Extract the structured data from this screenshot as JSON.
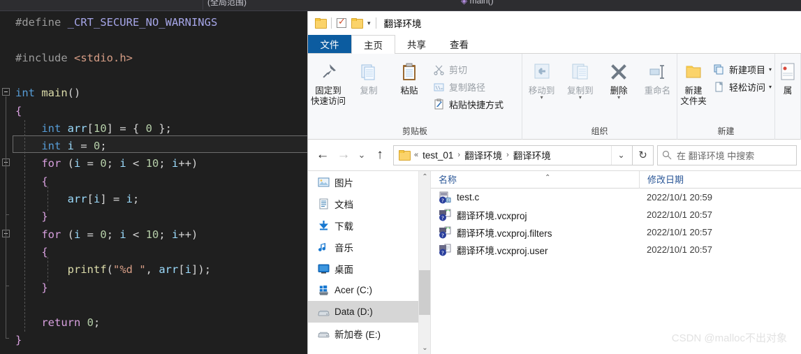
{
  "editor": {
    "combo_scope": "(全局范围)",
    "combo_function": "main()",
    "code_lines": [
      {
        "indent": 1,
        "tokens": [
          {
            "t": "#define ",
            "c": "c-pp"
          },
          {
            "t": "_CRT_SECURE_NO_WARNINGS",
            "c": "c-ppname"
          }
        ]
      },
      {
        "indent": 1,
        "tokens": []
      },
      {
        "indent": 1,
        "tokens": [
          {
            "t": "#include ",
            "c": "c-pp"
          },
          {
            "t": "<stdio.h>",
            "c": "c-str"
          }
        ]
      },
      {
        "indent": 1,
        "tokens": []
      },
      {
        "indent": 0,
        "tokens": [
          {
            "t": "int ",
            "c": "c-kw"
          },
          {
            "t": "main",
            "c": "c-fn"
          },
          {
            "t": "()",
            "c": "c-punct"
          }
        ]
      },
      {
        "indent": 0,
        "tokens": [
          {
            "t": "{",
            "c": "c-brace"
          }
        ]
      },
      {
        "indent": 0,
        "tokens": [
          {
            "t": "    ",
            "c": "c-punct"
          },
          {
            "t": "int ",
            "c": "c-kw"
          },
          {
            "t": "arr",
            "c": "c-var"
          },
          {
            "t": "[",
            "c": "c-punct"
          },
          {
            "t": "10",
            "c": "c-num"
          },
          {
            "t": "] = { ",
            "c": "c-punct"
          },
          {
            "t": "0",
            "c": "c-num"
          },
          {
            "t": " };",
            "c": "c-punct"
          }
        ]
      },
      {
        "indent": 0,
        "tokens": [
          {
            "t": "    ",
            "c": "c-punct"
          },
          {
            "t": "int ",
            "c": "c-kw"
          },
          {
            "t": "i",
            "c": "c-var"
          },
          {
            "t": " = ",
            "c": "c-punct"
          },
          {
            "t": "0",
            "c": "c-num"
          },
          {
            "t": ";",
            "c": "c-punct"
          }
        ]
      },
      {
        "indent": 0,
        "tokens": [
          {
            "t": "    ",
            "c": "c-punct"
          },
          {
            "t": "for",
            "c": "c-kw2"
          },
          {
            "t": " (",
            "c": "c-punct"
          },
          {
            "t": "i",
            "c": "c-var"
          },
          {
            "t": " = ",
            "c": "c-punct"
          },
          {
            "t": "0",
            "c": "c-num"
          },
          {
            "t": "; ",
            "c": "c-punct"
          },
          {
            "t": "i",
            "c": "c-var"
          },
          {
            "t": " < ",
            "c": "c-punct"
          },
          {
            "t": "10",
            "c": "c-num"
          },
          {
            "t": "; ",
            "c": "c-punct"
          },
          {
            "t": "i",
            "c": "c-var"
          },
          {
            "t": "++)",
            "c": "c-punct"
          }
        ]
      },
      {
        "indent": 0,
        "tokens": [
          {
            "t": "    {",
            "c": "c-brace"
          }
        ]
      },
      {
        "indent": 0,
        "tokens": [
          {
            "t": "        ",
            "c": "c-punct"
          },
          {
            "t": "arr",
            "c": "c-var"
          },
          {
            "t": "[",
            "c": "c-punct"
          },
          {
            "t": "i",
            "c": "c-var"
          },
          {
            "t": "] = ",
            "c": "c-punct"
          },
          {
            "t": "i",
            "c": "c-var"
          },
          {
            "t": ";",
            "c": "c-punct"
          }
        ]
      },
      {
        "indent": 0,
        "tokens": [
          {
            "t": "    }",
            "c": "c-brace"
          }
        ]
      },
      {
        "indent": 0,
        "tokens": [
          {
            "t": "    ",
            "c": "c-punct"
          },
          {
            "t": "for",
            "c": "c-kw2"
          },
          {
            "t": " (",
            "c": "c-punct"
          },
          {
            "t": "i",
            "c": "c-var"
          },
          {
            "t": " = ",
            "c": "c-punct"
          },
          {
            "t": "0",
            "c": "c-num"
          },
          {
            "t": "; ",
            "c": "c-punct"
          },
          {
            "t": "i",
            "c": "c-var"
          },
          {
            "t": " < ",
            "c": "c-punct"
          },
          {
            "t": "10",
            "c": "c-num"
          },
          {
            "t": "; ",
            "c": "c-punct"
          },
          {
            "t": "i",
            "c": "c-var"
          },
          {
            "t": "++)",
            "c": "c-punct"
          }
        ]
      },
      {
        "indent": 0,
        "tokens": [
          {
            "t": "    {",
            "c": "c-brace"
          }
        ]
      },
      {
        "indent": 0,
        "tokens": [
          {
            "t": "        ",
            "c": "c-punct"
          },
          {
            "t": "printf",
            "c": "c-fn"
          },
          {
            "t": "(",
            "c": "c-punct"
          },
          {
            "t": "\"%d \"",
            "c": "c-fmt"
          },
          {
            "t": ", ",
            "c": "c-punct"
          },
          {
            "t": "arr",
            "c": "c-var"
          },
          {
            "t": "[",
            "c": "c-punct"
          },
          {
            "t": "i",
            "c": "c-var"
          },
          {
            "t": "]);",
            "c": "c-punct"
          }
        ]
      },
      {
        "indent": 0,
        "tokens": [
          {
            "t": "    }",
            "c": "c-brace"
          }
        ]
      },
      {
        "indent": 0,
        "tokens": []
      },
      {
        "indent": 0,
        "tokens": [
          {
            "t": "    ",
            "c": "c-punct"
          },
          {
            "t": "return",
            "c": "c-kw2"
          },
          {
            "t": " ",
            "c": "c-punct"
          },
          {
            "t": "0",
            "c": "c-num"
          },
          {
            "t": ";",
            "c": "c-punct"
          }
        ]
      },
      {
        "indent": 0,
        "tokens": [
          {
            "t": "}",
            "c": "c-brace"
          }
        ]
      }
    ]
  },
  "explorer": {
    "title": "翻译环境",
    "quick_access": {
      "folder_icon": "folder-icon",
      "properties_icon": "properties-checkbox-icon",
      "new_folder_icon": "new-folder-icon",
      "caret": "▾"
    },
    "tabs": [
      {
        "label": "文件",
        "kind": "file"
      },
      {
        "label": "主页",
        "kind": "active"
      },
      {
        "label": "共享",
        "kind": "normal"
      },
      {
        "label": "查看",
        "kind": "normal"
      }
    ],
    "ribbon": {
      "groups": [
        {
          "label": "剪贴板",
          "big_buttons": [
            {
              "label": "固定到\n快速访问",
              "icon": "pin-icon",
              "dim": false
            },
            {
              "label": "复制",
              "icon": "copy-icon",
              "dim": true
            },
            {
              "label": "粘贴",
              "icon": "paste-icon",
              "dim": false
            }
          ],
          "small_buttons": [
            {
              "label": "剪切",
              "icon": "scissors-icon",
              "dim": true
            },
            {
              "label": "复制路径",
              "icon": "copy-path-icon",
              "dim": true
            },
            {
              "label": "粘贴快捷方式",
              "icon": "paste-shortcut-icon",
              "dim": false
            }
          ]
        },
        {
          "label": "组织",
          "big_buttons": [
            {
              "label": "移动到",
              "icon": "move-to-icon",
              "dim": true,
              "caret": "▾"
            },
            {
              "label": "复制到",
              "icon": "copy-to-icon",
              "dim": true,
              "caret": "▾"
            },
            {
              "label": "删除",
              "icon": "delete-icon",
              "dim": false,
              "caret": "▾"
            },
            {
              "label": "重命名",
              "icon": "rename-icon",
              "dim": true
            }
          ],
          "small_buttons": []
        },
        {
          "label": "新建",
          "big_buttons": [
            {
              "label": "新建\n文件夹",
              "icon": "new-folder-icon",
              "dim": false
            }
          ],
          "small_buttons": [
            {
              "label": "新建项目",
              "icon": "new-item-icon",
              "dim": false,
              "caret": "▾"
            },
            {
              "label": "轻松访问",
              "icon": "easy-access-icon",
              "dim": false,
              "caret": "▾"
            }
          ]
        },
        {
          "label": "",
          "big_buttons": [
            {
              "label": "属",
              "icon": "properties-icon",
              "dim": false
            }
          ],
          "small_buttons": []
        }
      ]
    },
    "addressbar": {
      "back_icon": "back-arrow-icon",
      "forward_icon": "forward-arrow-icon",
      "recent_icon": "recent-locations-icon",
      "up_icon": "up-arrow-icon",
      "path_icon": "folder-icon",
      "overflow": "«",
      "crumbs": [
        "test_01",
        "翻译环境",
        "翻译环境"
      ],
      "separator": "›",
      "dropdown_caret": "⌄",
      "refresh_icon": "refresh-icon",
      "search_placeholder": "在 翻译环境 中搜索",
      "search_icon": "search-icon"
    },
    "navpane": {
      "items": [
        {
          "label": "图片",
          "icon": "pictures-icon",
          "selected": false
        },
        {
          "label": "文档",
          "icon": "documents-icon",
          "selected": false
        },
        {
          "label": "下载",
          "icon": "downloads-icon",
          "selected": false
        },
        {
          "label": "音乐",
          "icon": "music-icon",
          "selected": false
        },
        {
          "label": "桌面",
          "icon": "desktop-icon",
          "selected": false
        },
        {
          "label": "Acer (C:)",
          "icon": "windows-drive-icon",
          "selected": false
        },
        {
          "label": "Data (D:)",
          "icon": "drive-icon",
          "selected": true
        },
        {
          "label": "新加卷 (E:)",
          "icon": "drive-icon",
          "selected": false
        }
      ],
      "scroll_up_icon": "chevron-up-icon",
      "scroll_down_icon": "chevron-down-icon"
    },
    "filelist": {
      "columns": [
        {
          "label": "名称",
          "key": "name"
        },
        {
          "label": "修改日期",
          "key": "date"
        }
      ],
      "sort_indicator": "⌃",
      "rows": [
        {
          "name": "test.c",
          "date": "2022/10/1 20:59",
          "icon": "c-source-file-icon"
        },
        {
          "name": "翻译环境.vcxproj",
          "date": "2022/10/1 20:57",
          "icon": "vcxproj-file-icon"
        },
        {
          "name": "翻译环境.vcxproj.filters",
          "date": "2022/10/1 20:57",
          "icon": "vcxproj-file-icon"
        },
        {
          "name": "翻译环境.vcxproj.user",
          "date": "2022/10/1 20:57",
          "icon": "vcxproj-user-file-icon"
        }
      ]
    }
  },
  "watermark": "CSDN @malloc不出对象"
}
